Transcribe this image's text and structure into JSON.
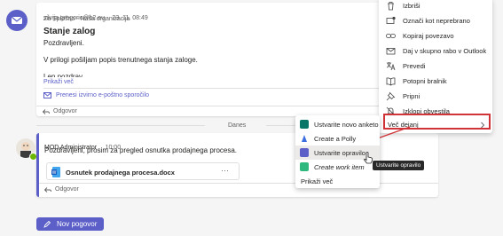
{
  "message1": {
    "sender": "silvija.gregoric@b2.eu",
    "time": "23. 11. 08:49",
    "to": "Za Splošno - Naša organizacija",
    "subject": "Stanje zalog",
    "greeting": "Pozdravljeni.",
    "body": "V prilogi pošiljam popis trenutnega stanja zaloge.",
    "cut_text": "Lep pozdrav",
    "show_more": "Prikaži več",
    "download_link": "Prenesi izvirno e-poštno sporočilo",
    "reply": "Odgovor"
  },
  "date_divider": "Danes",
  "message2": {
    "sender": "MOD Administrator",
    "time": "10:00",
    "body": "Pozdravljeni, prosim za pregled osnutka prodajnega procesa.",
    "file_name": "Osnutek prodajnega procesa.docx",
    "file_more": "···",
    "reply": "Odgovor"
  },
  "new_conversation": "Nov pogovor",
  "context_menu": {
    "items": [
      {
        "label": "Izbriši",
        "icon": "trash-icon"
      },
      {
        "label": "Označi kot neprebrano",
        "icon": "unread-icon"
      },
      {
        "label": "Kopiraj povezavo",
        "icon": "link-icon"
      },
      {
        "label": "Daj v skupno rabo v Outlook",
        "icon": "mail-icon"
      },
      {
        "label": "Prevedi",
        "icon": "translate-icon"
      },
      {
        "label": "Potopni bralnik",
        "icon": "reader-icon"
      },
      {
        "label": "Pripni",
        "icon": "pin-icon"
      },
      {
        "label": "Izklopi obvestila",
        "icon": "bell-off-icon"
      },
      {
        "label": "Več dejanj",
        "icon": "more-icon"
      }
    ]
  },
  "submenu": {
    "items": [
      {
        "label": "Ustvarite novo anketo",
        "icon": "forms-icon",
        "color": "#077568"
      },
      {
        "label": "Create a Polly",
        "icon": "polly-icon",
        "color": "#3c6fe0"
      },
      {
        "label": "Ustvarite opravilo",
        "icon": "planner-icon",
        "color": "#5b5fc7"
      },
      {
        "label": "Create work item",
        "icon": "workitem-icon",
        "color": "#2db87d"
      },
      {
        "label": "Prikaži več",
        "icon": "",
        "color": ""
      }
    ]
  },
  "tooltip": "Ustvarite opravilo",
  "colors": {
    "accent": "#5b5fc7",
    "highlight": "#d13438"
  }
}
